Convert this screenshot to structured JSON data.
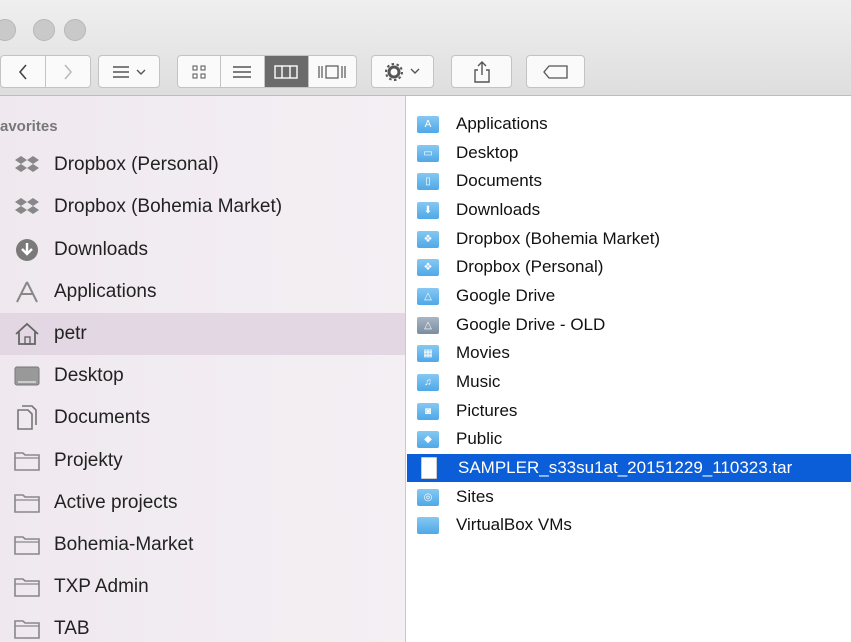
{
  "sidebar": {
    "header": "avorites",
    "items": [
      {
        "label": "Dropbox (Personal)",
        "icon": "dropbox-icon"
      },
      {
        "label": "Dropbox (Bohemia Market)",
        "icon": "dropbox-icon"
      },
      {
        "label": "Downloads",
        "icon": "downloads-icon"
      },
      {
        "label": "Applications",
        "icon": "applications-icon"
      },
      {
        "label": "petr",
        "icon": "home-icon"
      },
      {
        "label": "Desktop",
        "icon": "desktop-icon"
      },
      {
        "label": "Documents",
        "icon": "documents-icon"
      },
      {
        "label": "Projekty",
        "icon": "folder-icon"
      },
      {
        "label": "Active projects",
        "icon": "folder-icon"
      },
      {
        "label": "Bohemia-Market",
        "icon": "folder-icon"
      },
      {
        "label": "TXP Admin",
        "icon": "folder-icon"
      },
      {
        "label": "TAB",
        "icon": "folder-icon"
      }
    ]
  },
  "files": [
    {
      "name": "Applications",
      "icon": "applications-folder-icon"
    },
    {
      "name": "Desktop",
      "icon": "desktop-folder-icon"
    },
    {
      "name": "Documents",
      "icon": "documents-folder-icon"
    },
    {
      "name": "Downloads",
      "icon": "downloads-folder-icon"
    },
    {
      "name": "Dropbox (Bohemia Market)",
      "icon": "dropbox-folder-icon"
    },
    {
      "name": "Dropbox (Personal)",
      "icon": "dropbox-folder-icon"
    },
    {
      "name": "Google Drive",
      "icon": "google-drive-folder-icon"
    },
    {
      "name": "Google Drive - OLD",
      "icon": "google-drive-folder-icon"
    },
    {
      "name": "Movies",
      "icon": "movies-folder-icon"
    },
    {
      "name": "Music",
      "icon": "music-folder-icon"
    },
    {
      "name": "Pictures",
      "icon": "pictures-folder-icon"
    },
    {
      "name": "Public",
      "icon": "public-folder-icon"
    },
    {
      "name": "SAMPLER_s33su1at_20151229_110323.tar",
      "icon": "archive-file-icon"
    },
    {
      "name": "Sites",
      "icon": "sites-folder-icon"
    },
    {
      "name": "VirtualBox VMs",
      "icon": "folder-icon"
    }
  ],
  "selection": {
    "sidebar_selected": "petr",
    "file_selected": "SAMPLER_s33su1at_20151229_110323.tar"
  },
  "colors": {
    "selection_blue": "#0b5ed7",
    "folder_blue": "#5aa9e8",
    "sidebar_bg": "#f2edf2"
  }
}
